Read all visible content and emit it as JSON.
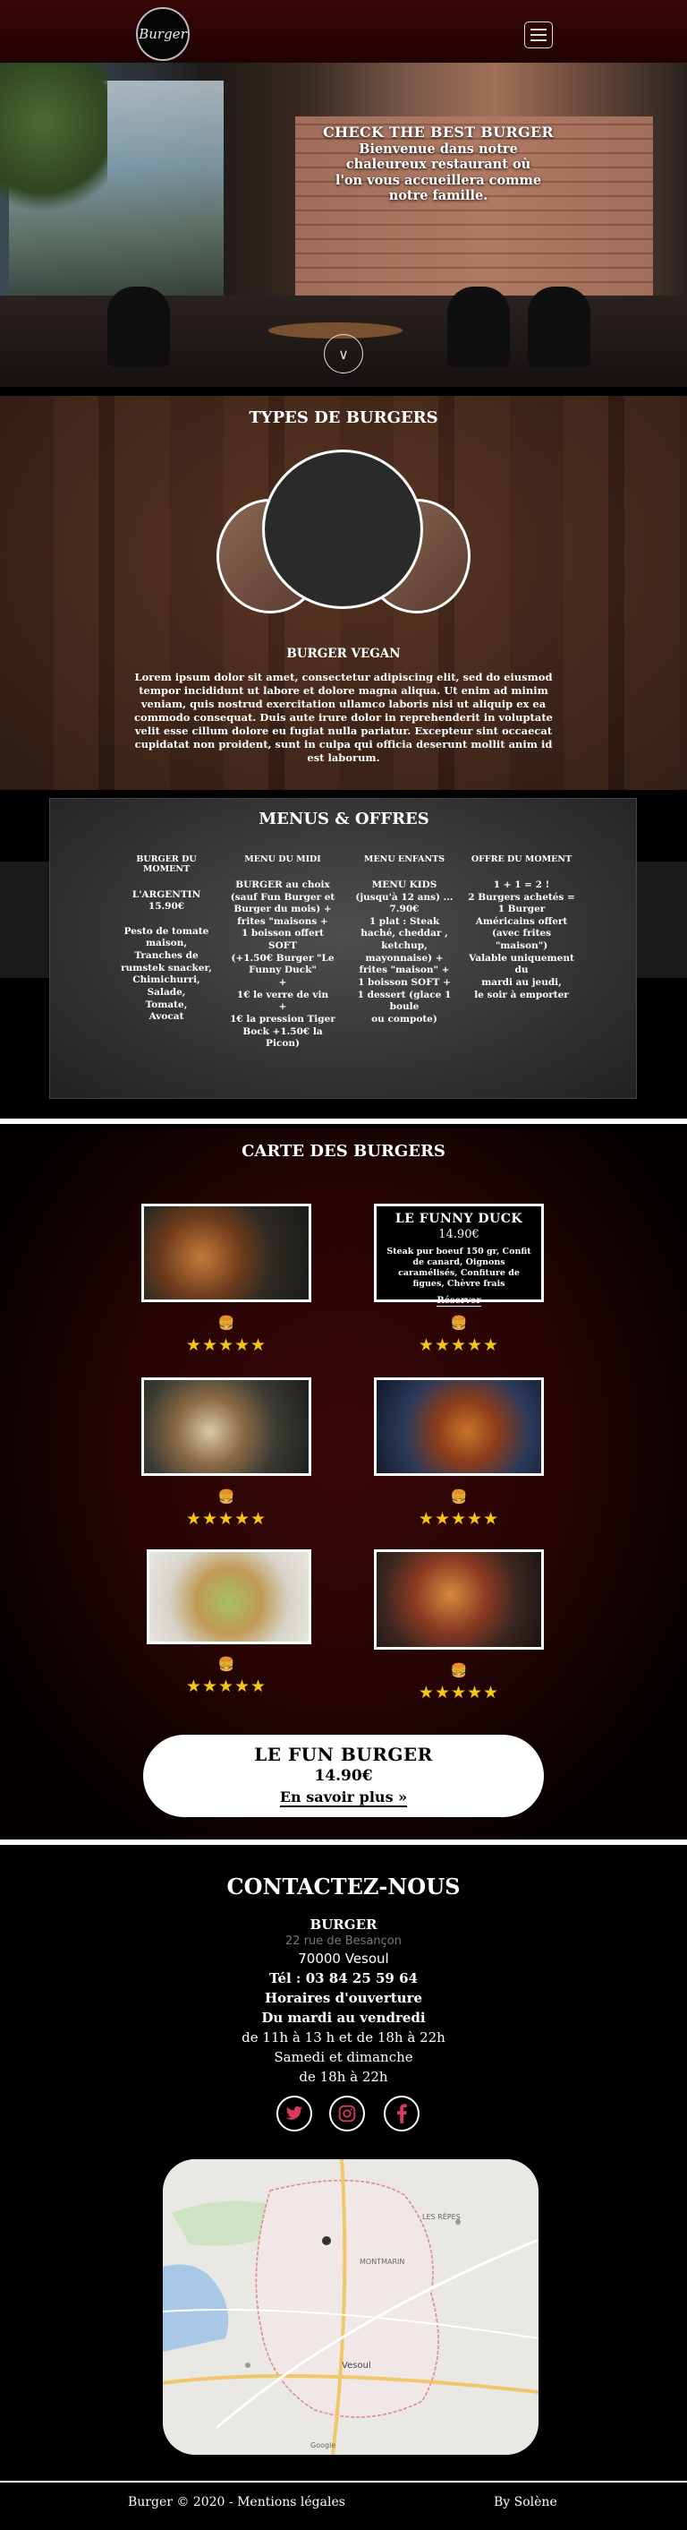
{
  "header": {
    "logo_text": "Burger"
  },
  "hero": {
    "title": "CHECK THE BEST BURGER",
    "subtitle": "Bienvenue dans notre chaleureux restaurant où l'on vous accueillera comme notre famille."
  },
  "types": {
    "title": "TYPES DE BURGERS",
    "featured_title": "BURGER VEGAN",
    "featured_text": "Lorem ipsum dolor sit amet, consectetur adipiscing elit, sed do eiusmod tempor incididunt ut labore et dolore magna aliqua. Ut enim ad minim veniam, quis nostrud exercitation ullamco laboris nisi ut aliquip ex ea commodo consequat. Duis aute irure dolor in reprehenderit in voluptate velit esse cillum dolore eu fugiat nulla pariatur. Excepteur sint occaecat cupidatat non proident, sunt in culpa qui officia deserunt mollit anim id est laborum."
  },
  "menus": {
    "title": "MENUS & OFFRES",
    "columns": [
      {
        "heading": "BURGER DU MOMENT",
        "text": "L'ARGENTIN\n15.90€\n\nPesto de tomate maison,\nTranches de rumstek snacker,\nChimichurri,\nSalade,\nTomate,\nAvocat"
      },
      {
        "heading": "MENU DU MIDI",
        "text": "BURGER au choix\n(sauf Fun Burger et Burger du mois) +\nfrites \"maisons +\n1 boisson offert\nSOFT\n(+1.50€ Burger \"Le Funny Duck\"\n+\n1€ le verre de vin\n+\n1€ la pression Tiger\nBock +1.50€ la Picon)"
      },
      {
        "heading": "MENU ENFANTS",
        "text": "MENU KIDS\n(jusqu'à 12 ans) ...\n7.90€\n1 plat : Steak haché, cheddar , ketchup, mayonnaise) +\nfrites \"maison\" +\n1 boisson SOFT +\n1 dessert (glace 1 boule\nou compote)"
      },
      {
        "heading": "OFFRE DU MOMENT",
        "text": "1 + 1 = 2 !\n2 Burgers achetés = 1 Burger\nAméricains offert\n(avec frites \"maison\")\nValable uniquement du\nmardi au jeudi,\nle soir à emporter"
      }
    ]
  },
  "carte": {
    "title": "CARTE DES BURGERS",
    "stars": "★★★★★",
    "bun_icon": "🍔",
    "duck": {
      "name": "LE FUNNY DUCK",
      "price": "14.90€",
      "description": "Steak pur boeuf 150 gr, Confit de canard, Oignons caramélisés, Confiture de figues, Chèvre frais",
      "link": "Réserver"
    },
    "fun": {
      "name": "LE FUN BURGER",
      "price": "14.90€",
      "link": "En savoir plus »"
    }
  },
  "contact": {
    "title": "CONTACTEZ-NOUS",
    "name": "BURGER",
    "street": "22 rue de Besançon",
    "city": "70000 Vesoul",
    "phone": "Tél : 03 84 25 59 64",
    "hours_title": "Horaires d'ouverture",
    "weekdays": "Du mardi au vendredi",
    "weekday_hours": "de 11h à 13 h et de 18h à 22h",
    "weekend": "Samedi et dimanche",
    "weekend_hours": "de 18h à 22h"
  },
  "map": {
    "labels": [
      "Vesoul",
      "MONTMARIN",
      "LES RÊPES",
      "Google"
    ]
  },
  "footer": {
    "left": "Burger © 2020 - Mentions légales",
    "right": "By Solène"
  },
  "colors": {
    "header": "#2a0404",
    "stars": "#f5c518",
    "carte_bg": "#260404"
  }
}
